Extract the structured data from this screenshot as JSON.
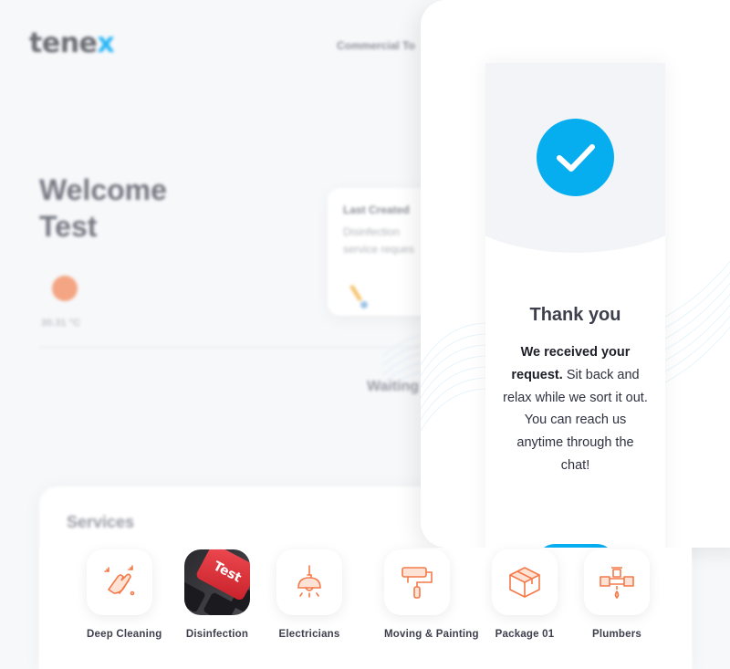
{
  "app": {
    "logo_main": "tene",
    "logo_accent": "x"
  },
  "header": {
    "nav_link": "Commercial To"
  },
  "welcome": {
    "line1": "Welcome",
    "line2": "Test"
  },
  "weather": {
    "temperature": "30.31 °C"
  },
  "last_created": {
    "title": "Last Created",
    "subtitle_line1": "Disinfection",
    "subtitle_line2": "service reques"
  },
  "waiting": "Waiting",
  "services": {
    "title": "Services",
    "items": [
      {
        "label": "Deep Cleaning",
        "icon": "cleaning-hands-icon"
      },
      {
        "label": "Disinfection",
        "icon": "test-keyboard-photo"
      },
      {
        "label": "Electricians",
        "icon": "ceiling-lamp-icon"
      },
      {
        "label": "Moving & Painting",
        "icon": "paint-roller-icon"
      },
      {
        "label": "Package 01",
        "icon": "package-box-icon"
      },
      {
        "label": "Plumbers",
        "icon": "pipe-valve-icon"
      }
    ],
    "photo_text": "Test"
  },
  "modal": {
    "icon": "check-circle-icon",
    "title": "Thank you",
    "message_bold": "We received your request.",
    "message_rest": "Sit back and relax while we sort it out. You can reach us anytime through the chat!"
  },
  "colors": {
    "accent": "#06adef",
    "icon_orange": "#f47a4a",
    "text_dark": "#3e3f4d"
  }
}
